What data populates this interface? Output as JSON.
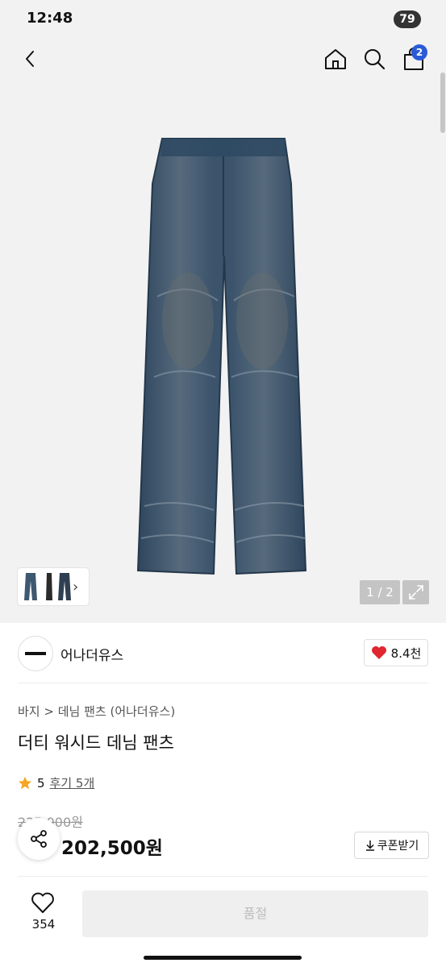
{
  "status_bar": {
    "time": "12:48",
    "battery": "79"
  },
  "header": {
    "cart_count": "2"
  },
  "gallery": {
    "counter": "1 / 2"
  },
  "brand": {
    "name": "어나더유스",
    "likes": "8.4천"
  },
  "product": {
    "breadcrumb": [
      "바지",
      "데님 팬츠 (어나더유스)"
    ],
    "title": "더티 워시드 데님 팬츠",
    "rating": "5",
    "review_link": "후기 5개",
    "original_price": "225,000원",
    "sale_price": "202,500원",
    "coupon_label": "쿠폰받기"
  },
  "bottom_bar": {
    "wish_count": "354",
    "buy_label": "품절"
  },
  "colors": {
    "accent": "#2a5bd7",
    "heart": "#e0262f",
    "star": "#f5a623",
    "denim": "#3f5872"
  }
}
